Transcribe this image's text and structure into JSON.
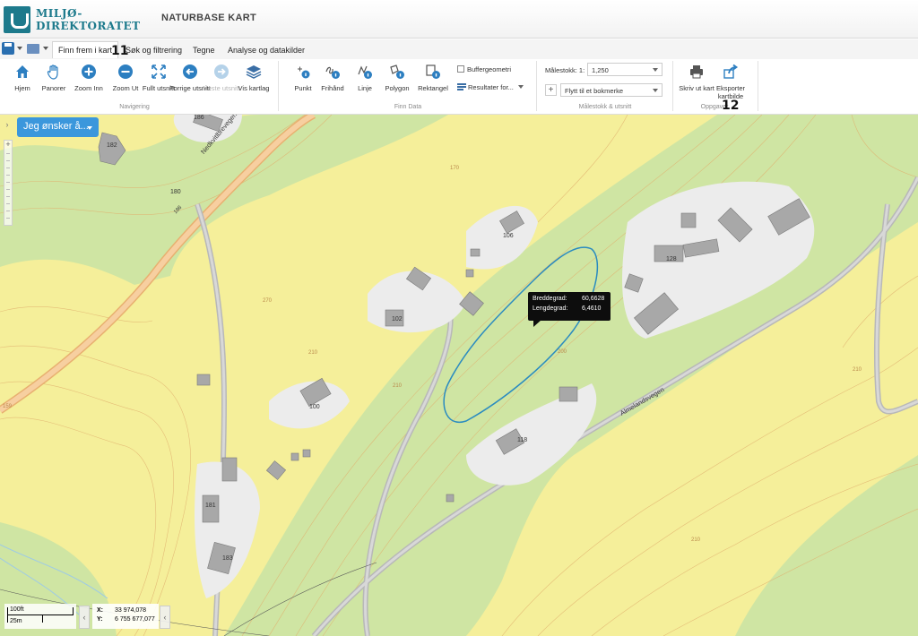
{
  "brand": {
    "line1": "MILJØ-",
    "line2": "DIREKTORATET",
    "app_title": "NATURBASE KART",
    "color": "#1d7a8c"
  },
  "menu": {
    "tabs": [
      {
        "label": "Finn frem i kart",
        "active": true
      },
      {
        "label": "Søk og filtrering"
      },
      {
        "label": "Tegne"
      },
      {
        "label": "Analyse og datakilder"
      }
    ]
  },
  "annotations": {
    "a11": "11",
    "a12": "12"
  },
  "ribbon": {
    "navigering": {
      "label": "Navigering",
      "buttons": [
        {
          "label": "Hjem",
          "icon": "home-icon"
        },
        {
          "label": "Panorer",
          "icon": "hand-icon"
        },
        {
          "label": "Zoom Inn",
          "icon": "zoom-in-icon"
        },
        {
          "label": "Zoom Ut",
          "icon": "zoom-out-icon"
        },
        {
          "label": "Fullt utsnitt",
          "icon": "full-extent-icon"
        },
        {
          "label": "Forrige utsnitt",
          "icon": "back-arrow-icon"
        },
        {
          "label": "Neste utsnitt",
          "icon": "forward-arrow-icon",
          "disabled": true
        },
        {
          "label": "Vis kartlag",
          "icon": "layers-icon"
        }
      ]
    },
    "finn_data": {
      "label": "Finn Data",
      "buttons": [
        {
          "label": "Punkt",
          "icon": "point-info-icon"
        },
        {
          "label": "Frihånd",
          "icon": "freehand-info-icon"
        },
        {
          "label": "Linje",
          "icon": "line-info-icon"
        },
        {
          "label": "Polygon",
          "icon": "polygon-info-icon"
        },
        {
          "label": "Rektangel",
          "icon": "rectangle-info-icon"
        }
      ],
      "buffer_label": "Buffergeometri",
      "results_label": "Resultater for..."
    },
    "malestokk": {
      "label": "Målestokk & utsnitt",
      "scale_label": "Målestokk: 1:",
      "scale_value": "1,250",
      "bookmark_placeholder": "Flytt til et bokmerke"
    },
    "oppgaver": {
      "label": "Oppgaver",
      "buttons": [
        {
          "label": "Skriv ut kart",
          "icon": "printer-icon"
        },
        {
          "label": "Eksporter kartbilde",
          "icon": "export-icon"
        }
      ]
    }
  },
  "map": {
    "wish_button": "Jeg ønsker å...",
    "tooltip": {
      "lat_label": "Breddegrad:",
      "lat_value": "60,6628",
      "lon_label": "Lengdegrad:",
      "lon_value": "6,4610"
    },
    "scalebar": {
      "top": "100ft",
      "bottom": "25m"
    },
    "coords": {
      "x_label": "X:",
      "x_value": "33 974,078",
      "y_label": "Y:",
      "y_value": "6 755 677,077"
    },
    "building_numbers": [
      "186",
      "182",
      "180",
      "106",
      "128",
      "102",
      "100",
      "118",
      "181",
      "183"
    ],
    "roads": [
      "Nedkvitlbrevegen",
      "Almelandsvegen"
    ],
    "road_number": "186",
    "contours": [
      "170",
      "210",
      "200",
      "210",
      "210",
      "159",
      "270",
      "210"
    ],
    "colors": {
      "land_yellow": "#f5ef9a",
      "forest_green": "#cfe5a3",
      "road": "#f2c48a",
      "polygon": "#2a8bc0"
    }
  }
}
